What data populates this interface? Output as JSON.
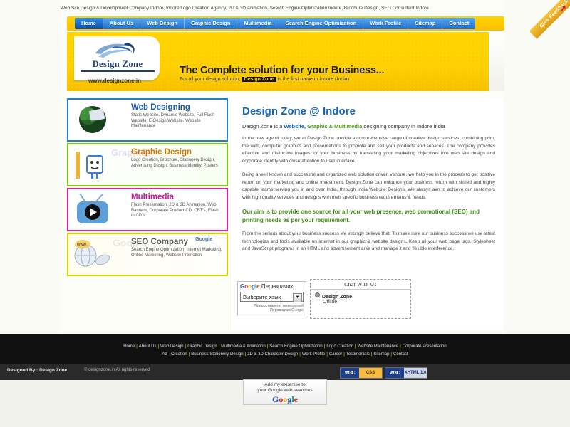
{
  "top_tagline": "Web Site Design & Development Company Indore, Indore Logo Creation Agency, 2D & 3D animation, Search Engine Optimization Indore, Brochure Design, SEO Consultant Indore",
  "ribbon": {
    "label": "Give Feedback",
    "icon": "arrow-icon"
  },
  "nav": {
    "items": [
      {
        "label": "Home",
        "active": true
      },
      {
        "label": "About Us",
        "active": false
      },
      {
        "label": "Web Design",
        "active": false
      },
      {
        "label": "Graphic Design",
        "active": false
      },
      {
        "label": "Multimedia",
        "active": false
      },
      {
        "label": "Search Engine Optimization",
        "active": false
      },
      {
        "label": "Work Profile",
        "active": false
      },
      {
        "label": "Sitemap",
        "active": false
      },
      {
        "label": "Contact",
        "active": false
      }
    ]
  },
  "banner": {
    "logo_text": "Design Zone",
    "logo_url": "www.designzone.in",
    "headline": "The Complete solution for your Business...",
    "sub_prefix": "For all your design solution,",
    "sub_highlight": "Design Zone",
    "sub_suffix": "is the first name in Indore (India)"
  },
  "services": [
    {
      "title": "Web Designing",
      "desc": "Static Website, Dynamic Website, Full Flash Website, E-Design Website, Website Maintenance",
      "thumb": "globe-monitor-icon",
      "accent": "#1e7fd4"
    },
    {
      "title": "Graphic Design",
      "desc": "Logo Creation, Brochure, Stationery Design, Advertising Design, Business Identity, Posters",
      "thumb": "mascot-pencil-icon",
      "accent": "#7ac514",
      "ghost": "Graphics"
    },
    {
      "title": "Multimedia",
      "desc": "Flash Presentation, 2D & 3D Animation, Web Banners, Corporate Product CD, CBT's, Flash in CD's",
      "thumb": "television-icon",
      "accent": "#e020a0"
    },
    {
      "title": "SEO Company",
      "desc": "Search Engine Optimization, Internet Marketing, Online Marketing, Website Promotion",
      "thumb": "www-globe-mouse-icon",
      "accent": "#d2d400",
      "ghost": "Google",
      "badge": "Google"
    }
  ],
  "content": {
    "title": "Design Zone @ Indore",
    "lead_prefix": "Design Zone is a",
    "lead_blue": "Website,",
    "lead_green": "Graphic & Multimedia",
    "lead_suffix": "designing company in Indore India",
    "para1": "In the new age of today, we at Design Zone provide a comprehensive range of creative design services, combining print, the web, computer graphics and presentations to promote and sell your products and services. The company provides effective and distinctive images for your business by translating your marketing objectives into web site design and corporate identity with close attention to user interface.",
    "para2": "Being a well known and successful and organized web solution driven venture, we help you in the process to get positive return on your marketing and online investment. Design Zone can enhance your business return with skilled and highly capable teams serving you in and over India, through India Website Designs. We always aim to achieve our customers with high quality services and designs with their specific business requirements & needs.",
    "aim": "Our aim is to provide one source for all your web presence, web promotional (SEO) and printing needs as per your requirement.",
    "para3": "From the serious about your business success we strongly believe that. To make sure our business success we use latest technologies and tools available on internet in our graphic & website designs. Keep all your web page tags, Stylesheet and JavaScript programs in an HTML and advertisement area and manage it and flexible interference."
  },
  "translate_widget": {
    "brand": "Google",
    "title": "Переводчик",
    "selected_language": "Выберите язык",
    "powered_line1": "Предоставлено технологией",
    "powered_line2": "Переводчик Google",
    "caret": "chevron-down-icon"
  },
  "chat_widget": {
    "title": "Chat With Us",
    "agent": "Design Zone",
    "status": "Offline"
  },
  "footer": {
    "row1": [
      "Home",
      "About Us",
      "Web Design",
      "Graphic Design",
      "Multimedia & Animation",
      "Search Engine Optimization",
      "Logo Creation",
      "Website Maintenance",
      "Corporate Presentation"
    ],
    "row2": [
      "Ad - Creation",
      "Business Stationery Design",
      "2D & 3D Character Design",
      "Work Profile",
      "Career",
      "Testimonials",
      "Sitemap",
      "Contact"
    ],
    "designed_by": "Designed By : Design Zone",
    "copyright": "© designzone.in All rights reserved",
    "badges": [
      {
        "label": "W3C",
        "value": "CSS"
      },
      {
        "label": "W3C",
        "value": "XHTML 1.0"
      }
    ],
    "google_box": {
      "line1": "Add my expertise to",
      "line2": "your Google web searches",
      "logo": "Google"
    }
  }
}
